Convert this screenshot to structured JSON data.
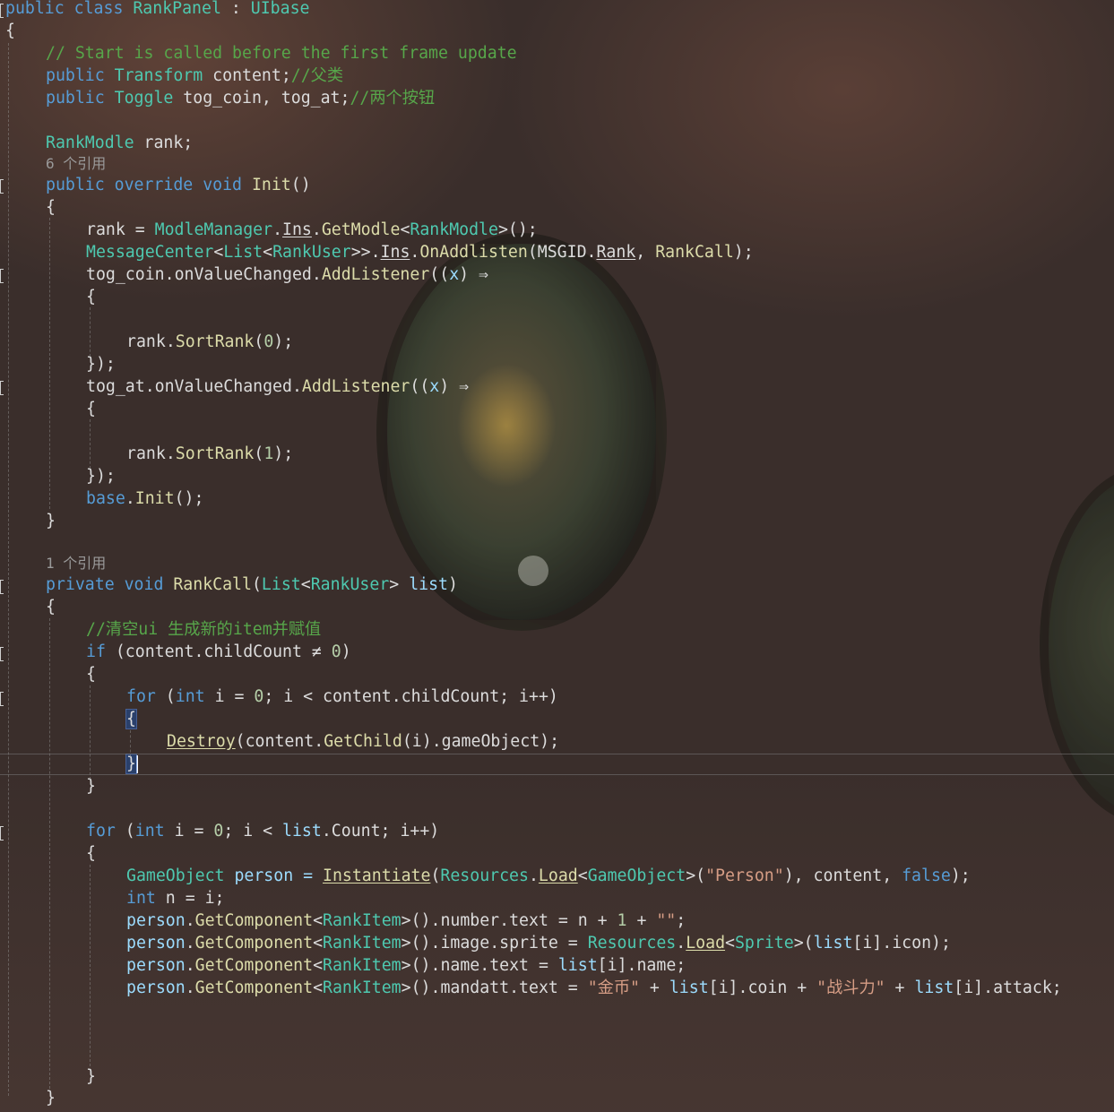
{
  "code": {
    "class_decl": {
      "kw": "public class",
      "name": "RankPanel",
      "sep": " : ",
      "base": "UIbase"
    },
    "open_brace": "{",
    "close_brace": "}",
    "comment_start": "// Start is called before the first frame update",
    "field_content": {
      "kw": "public",
      "type": "Transform",
      "name": " content;",
      "comment": "//父类"
    },
    "field_toggle": {
      "kw": "public",
      "type": "Toggle",
      "name": " tog_coin, tog_at;",
      "comment": "//两个按钮"
    },
    "field_rank": {
      "type": "RankModle",
      "name": " rank;"
    },
    "refs_init": "6 个引用",
    "init_sig": {
      "kw": "public override void",
      "name": "Init",
      "tail": "()"
    },
    "l_rank_assign": {
      "a": "rank = ",
      "b": "ModleManager",
      "c": ".",
      "d": "Ins",
      "e": ".",
      "f": "GetModle",
      "g": "<",
      "h": "RankModle",
      "i": ">();"
    },
    "l_msgcenter": {
      "a": "MessageCenter",
      "b": "<",
      "c": "List",
      "d": "<",
      "e": "RankUser",
      "f": ">>.",
      "g": "Ins",
      "h": ".",
      "i": "OnAddlisten",
      "j": "(",
      "k": "MSGID",
      "l": ".",
      "m": "Rank",
      "n": ", ",
      "o": "RankCall",
      "p": ");"
    },
    "l_togcoin": {
      "a": "tog_coin",
      "b": ".",
      "c": "onValueChanged",
      "d": ".",
      "e": "AddListener",
      "f": "((",
      "g": "x",
      "h": ") ⇒"
    },
    "l_sort0": {
      "a": "rank",
      "b": ".",
      "c": "SortRank",
      "d": "(",
      "e": "0",
      "f": ");"
    },
    "l_close_lambda": "});",
    "l_togat": {
      "a": "tog_at",
      "b": ".",
      "c": "onValueChanged",
      "d": ".",
      "e": "AddListener",
      "f": "((",
      "g": "x",
      "h": ") ⇒"
    },
    "l_sort1": {
      "a": "rank",
      "b": ".",
      "c": "SortRank",
      "d": "(",
      "e": "1",
      "f": ");"
    },
    "l_base_init": {
      "a": "base",
      "b": ".",
      "c": "Init",
      "d": "();"
    },
    "refs_rankcall": "1 个引用",
    "rankcall_sig": {
      "kw": "private void",
      "name": "RankCall",
      "a": "(",
      "b": "List",
      "c": "<",
      "d": "RankUser",
      "e": "> ",
      "f": "list",
      "g": ")"
    },
    "comment_clear": "//清空ui 生成新的item并赋值",
    "l_if": {
      "kw": "if",
      "a": " (content",
      "b": ".",
      "c": "childCount ≠ ",
      "d": "0",
      "e": ")"
    },
    "l_for1": {
      "kw": "for",
      "a": " (",
      "b": "int",
      "c": " i = ",
      "d": "0",
      "e": "; i < content",
      "f": ".",
      "g": "childCount; i++)"
    },
    "l_destroy": {
      "a": "Destroy",
      "b": "(content",
      "c": ".",
      "d": "GetChild",
      "e": "(i)",
      "f": ".",
      "g": "gameObject);"
    },
    "l_for2": {
      "kw": "for",
      "a": " (",
      "b": "int",
      "c": " i = ",
      "d": "0",
      "e": "; i < ",
      "f": "list",
      "g": ".",
      "h": "Count; i++)"
    },
    "l_person": {
      "a": "GameObject",
      "b": " person = ",
      "c": "Instantiate",
      "d": "(",
      "e": "Resources",
      "f": ".",
      "g": "Load",
      "h": "<",
      "i": "GameObject",
      "j": ">(",
      "k": "\"Person\"",
      "l": "), content, ",
      "m": "false",
      "n": ");"
    },
    "l_int_n": {
      "a": "int",
      "b": " n = i;"
    },
    "l_number": {
      "a": "person",
      "b": ".",
      "c": "GetComponent",
      "d": "<",
      "e": "RankItem",
      "f": ">()",
      "g": ".",
      "h": "number",
      "i": ".",
      "j": "text = n + ",
      "k": "1",
      "l": " + ",
      "m": "\"\"",
      "n": ";"
    },
    "l_image": {
      "a": "person",
      "b": ".",
      "c": "GetComponent",
      "d": "<",
      "e": "RankItem",
      "f": ">()",
      "g": ".",
      "h": "image",
      "i": ".",
      "j": "sprite = ",
      "k": "Resources",
      "l": ".",
      "m": "Load",
      "n": "<",
      "o": "Sprite",
      "p": ">(",
      "q": "list",
      "r": "[i]",
      "s": ".",
      "t": "icon);"
    },
    "l_name": {
      "a": "person",
      "b": ".",
      "c": "GetComponent",
      "d": "<",
      "e": "RankItem",
      "f": ">()",
      "g": ".",
      "h": "name",
      "i": ".",
      "j": "text = ",
      "k": "list",
      "l": "[i]",
      "m": ".",
      "n": "name;"
    },
    "l_mandatt": {
      "a": "person",
      "b": ".",
      "c": "GetComponent",
      "d": "<",
      "e": "RankItem",
      "f": ">()",
      "g": ".",
      "h": "mandatt",
      "i": ".",
      "j": "text = ",
      "k": "\"金币\"",
      "l": " + ",
      "m": "list",
      "n": "[i]",
      "o": ".",
      "p": "coin + ",
      "q": "\"战斗力\"",
      "r": " + ",
      "s": "list",
      "t": "[i]",
      "u": ".",
      "v": "attack;"
    }
  },
  "colors": {
    "keyword": "#569cd6",
    "type": "#4ec9b0",
    "function": "#dcdcaa",
    "comment": "#57a64a",
    "string": "#d69d85",
    "number": "#b5cea8",
    "text": "#dcdcdc"
  }
}
